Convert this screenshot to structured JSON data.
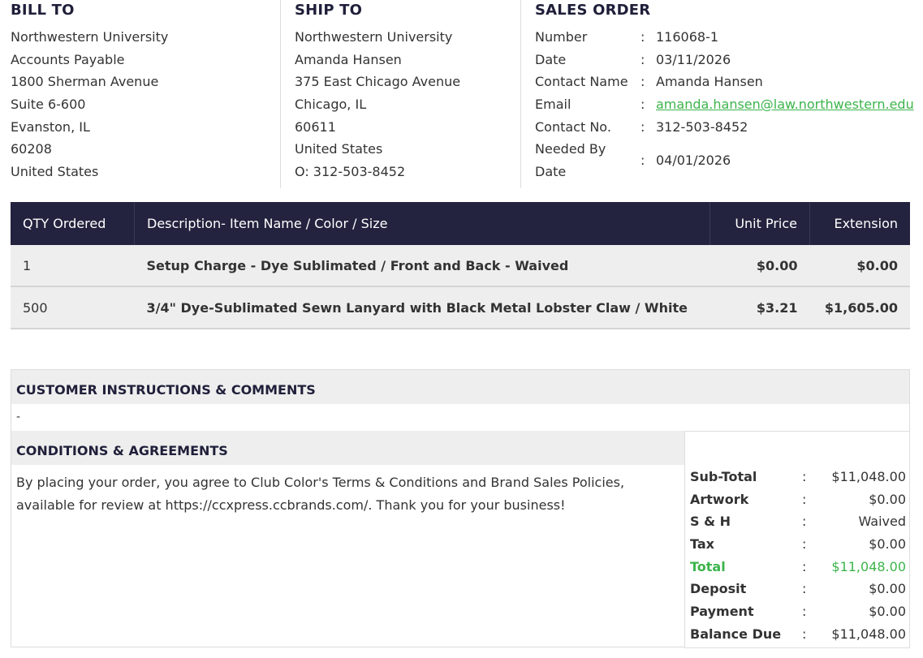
{
  "bill_to": {
    "heading": "BILL TO",
    "lines": [
      "Northwestern University",
      "Accounts Payable",
      "1800 Sherman Avenue",
      "Suite 6-600",
      "Evanston, IL",
      "60208",
      "United States"
    ]
  },
  "ship_to": {
    "heading": "SHIP TO",
    "lines": [
      "Northwestern University",
      "Amanda Hansen",
      "375 East Chicago Avenue",
      "Chicago, IL",
      "60611",
      "United States",
      "O: 312-503-8452"
    ]
  },
  "sales_order": {
    "heading": "SALES ORDER",
    "colon": ":",
    "number_label": "Number",
    "number": "116068-1",
    "date_label": "Date",
    "date": "03/11/2026",
    "contact_name_label": "Contact Name",
    "contact_name": "Amanda Hansen",
    "email_label": "Email",
    "email": "amanda.hansen@law.northwestern.edu",
    "contact_no_label": "Contact No.",
    "contact_no": "312-503-8452",
    "needed_by_label": "Needed By Date",
    "needed_by": "04/01/2026"
  },
  "items": {
    "headers": {
      "qty": "QTY Ordered",
      "description": "Description- Item Name / Color / Size",
      "unit_price": "Unit Price",
      "extension": "Extension"
    },
    "rows": [
      {
        "qty": "1",
        "description": "Setup Charge - Dye Sublimated / Front and Back - Waived",
        "unit_price": "$0.00",
        "extension": "$0.00"
      },
      {
        "qty": "500",
        "description": "3/4\" Dye-Sublimated Sewn Lanyard with Black Metal Lobster Claw / White",
        "unit_price": "$3.21",
        "extension": "$1,605.00"
      }
    ]
  },
  "instructions": {
    "heading": "CUSTOMER INSTRUCTIONS & COMMENTS",
    "text": "-"
  },
  "conditions": {
    "heading": "CONDITIONS & AGREEMENTS",
    "text": "By placing your order, you agree to Club Color's Terms & Conditions and Brand Sales Policies, available for review at https://ccxpress.ccbrands.com/. Thank you for your business!"
  },
  "totals": {
    "colon": ":",
    "subtotal_label": "Sub-Total",
    "subtotal": "$11,048.00",
    "artwork_label": "Artwork",
    "artwork": "$0.00",
    "sh_label": "S & H",
    "sh": "Waived",
    "tax_label": "Tax",
    "tax": "$0.00",
    "total_label": "Total",
    "total": "$11,048.00",
    "deposit_label": "Deposit",
    "deposit": "$0.00",
    "payment_label": "Payment",
    "payment": "$0.00",
    "balance_label": "Balance Due",
    "balance": "$11,048.00"
  },
  "colors": {
    "header_bg": "#23233f",
    "accent_green": "#3cb44b",
    "row_bg": "#eeeeee"
  }
}
